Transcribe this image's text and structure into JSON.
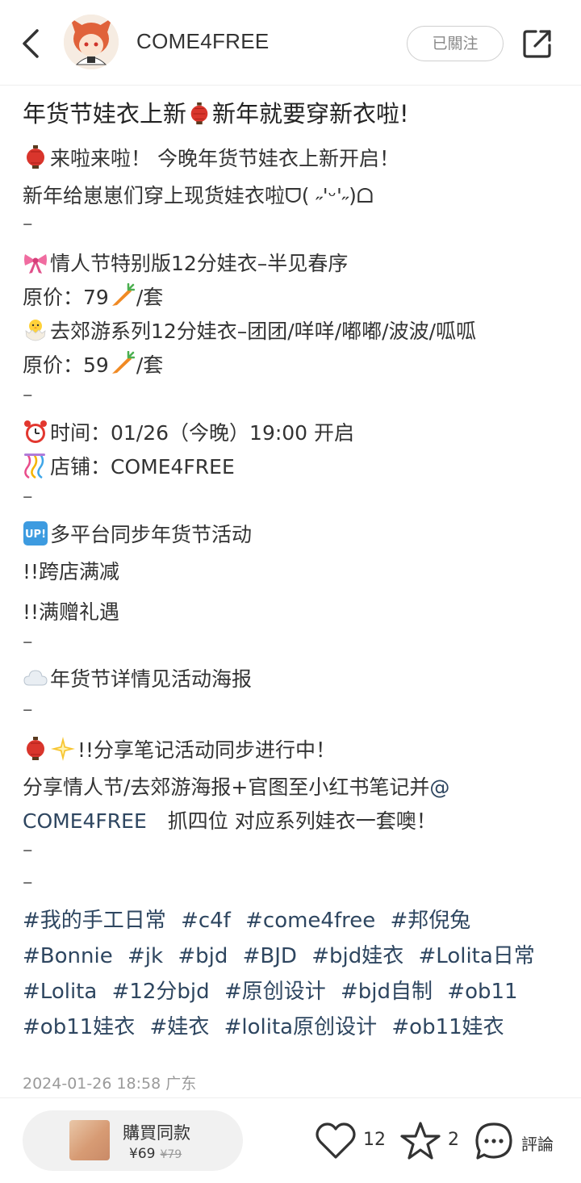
{
  "header": {
    "author_name": "COME4FREE",
    "follow_label": "已關注"
  },
  "post": {
    "title_part1": "年货节娃衣上新",
    "title_part2": "新年就要穿新衣啦!",
    "lines": {
      "l1": "来啦来啦！ 今晚年货节娃衣上新开启！",
      "l2": "新年给崽崽们穿上现货娃衣啦ᗜ( ˶'ᵕ'˶)ᗝ",
      "dash": "–",
      "l4": "情人节特别版12分娃衣–半见春序",
      "l5a": "原价：79",
      "l5b": "/套",
      "l6": "去郊游系列12分娃衣–团团/咩咩/嘟嘟/波波/呱呱",
      "l7a": "原价：59",
      "l7b": "/套",
      "l9": "时间：01/26（今晚）19:00 开启",
      "l10": "店铺：COME4FREE",
      "l12": "多平台同步年货节活动",
      "l13": "!!跨店满减",
      "l14": "!!满赠礼遇",
      "l16": "年货节详情见活动海报",
      "l18": "!!分享笔记活动同步进行中！",
      "l19a": "分享情人节/去郊游海报+官图至小红书笔记并",
      "l19b": "@",
      "l20a": "COME4FREE",
      "l20b": "抓四位 对应系列娃衣一套噢！"
    },
    "tags": [
      "#我的手工日常",
      "#c4f",
      "#come4free",
      "#邦倪兔",
      "#Bonnie",
      "#jk",
      "#bjd",
      "#BJD",
      "#bjd娃衣",
      "#Lolita日常",
      "#Lolita",
      "#12分bjd",
      "#原创设计",
      "#bjd自制",
      "#ob11",
      "#ob11娃衣",
      "#娃衣",
      "#lolita原创设计",
      "#ob11娃衣"
    ],
    "date": "2024-01-26 18:58 广东"
  },
  "bottom": {
    "buy_label": "購買同款",
    "price": "¥69",
    "original_price": "¥79",
    "likes": "12",
    "collects": "2",
    "comment_label": "評論"
  },
  "icons": {
    "back": "chevron-left-icon",
    "share": "share-icon",
    "like": "heart-icon",
    "collect": "star-icon",
    "comment": "comment-bubble-icon"
  },
  "colors": {
    "tag_color": "#2e4660",
    "lantern_red": "#d9352c"
  }
}
